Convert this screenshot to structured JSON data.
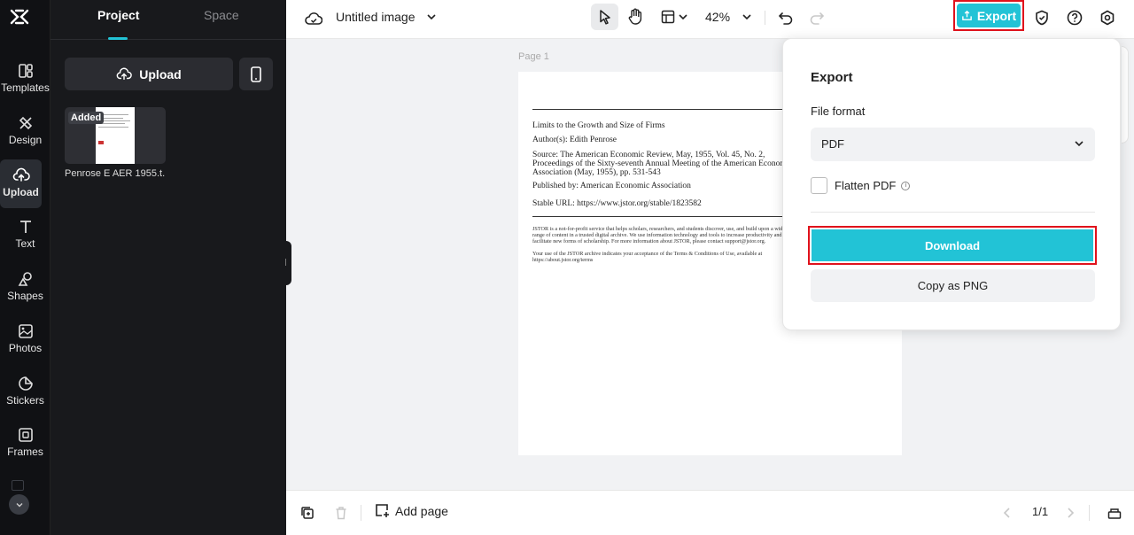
{
  "rail": {
    "items": [
      {
        "label": "Templates",
        "icon": "templates-icon"
      },
      {
        "label": "Design",
        "icon": "design-icon"
      },
      {
        "label": "Upload",
        "icon": "upload-icon",
        "active": true
      },
      {
        "label": "Text",
        "icon": "text-icon"
      },
      {
        "label": "Shapes",
        "icon": "shapes-icon"
      },
      {
        "label": "Photos",
        "icon": "photos-icon"
      },
      {
        "label": "Stickers",
        "icon": "stickers-icon"
      },
      {
        "label": "Frames",
        "icon": "frames-icon"
      }
    ]
  },
  "panel": {
    "tabs": [
      "Project",
      "Space"
    ],
    "upload_label": "Upload",
    "asset": {
      "badge": "Added",
      "name": "Penrose E AER 1955.t..."
    }
  },
  "topbar": {
    "title": "Untitled image",
    "zoom": "42%",
    "export_label": "Export"
  },
  "canvas": {
    "page_label": "Page 1",
    "doc_lines": [
      "Limits to the Growth and Size of Firms",
      "Author(s): Edith Penrose",
      "Source: The American Economic Review, May, 1955, Vol. 45, No. 2,",
      "Proceedings of the Sixty-seventh Annual Meeting of the American Economic",
      "Association (May, 1955), pp. 531-543",
      "Published by: American Economic Association",
      "Stable URL: https://www.jstor.org/stable/1823582"
    ],
    "doc_small": [
      "JSTOR is a not-for-profit service that helps scholars, researchers, and students discover, use, and build upon a wide",
      "range of content in a trusted digital archive. We use information technology and tools to increase productivity and",
      "facilitate new forms of scholarship. For more information about JSTOR, please contact support@jstor.org.",
      "Your use of the JSTOR archive indicates your acceptance of the Terms & Conditions of Use, available at",
      "https://about.jstor.org/terms"
    ]
  },
  "bottombar": {
    "add_page_label": "Add page",
    "pager": "1/1"
  },
  "export_panel": {
    "title": "Export",
    "file_format_label": "File format",
    "file_format_value": "PDF",
    "flatten_label": "Flatten PDF",
    "download_label": "Download",
    "copy_label": "Copy as PNG"
  },
  "colors": {
    "accent": "#22c3d6",
    "highlight_border": "#e0121c",
    "rail_bg": "#101114",
    "panel_bg": "#18191c"
  }
}
